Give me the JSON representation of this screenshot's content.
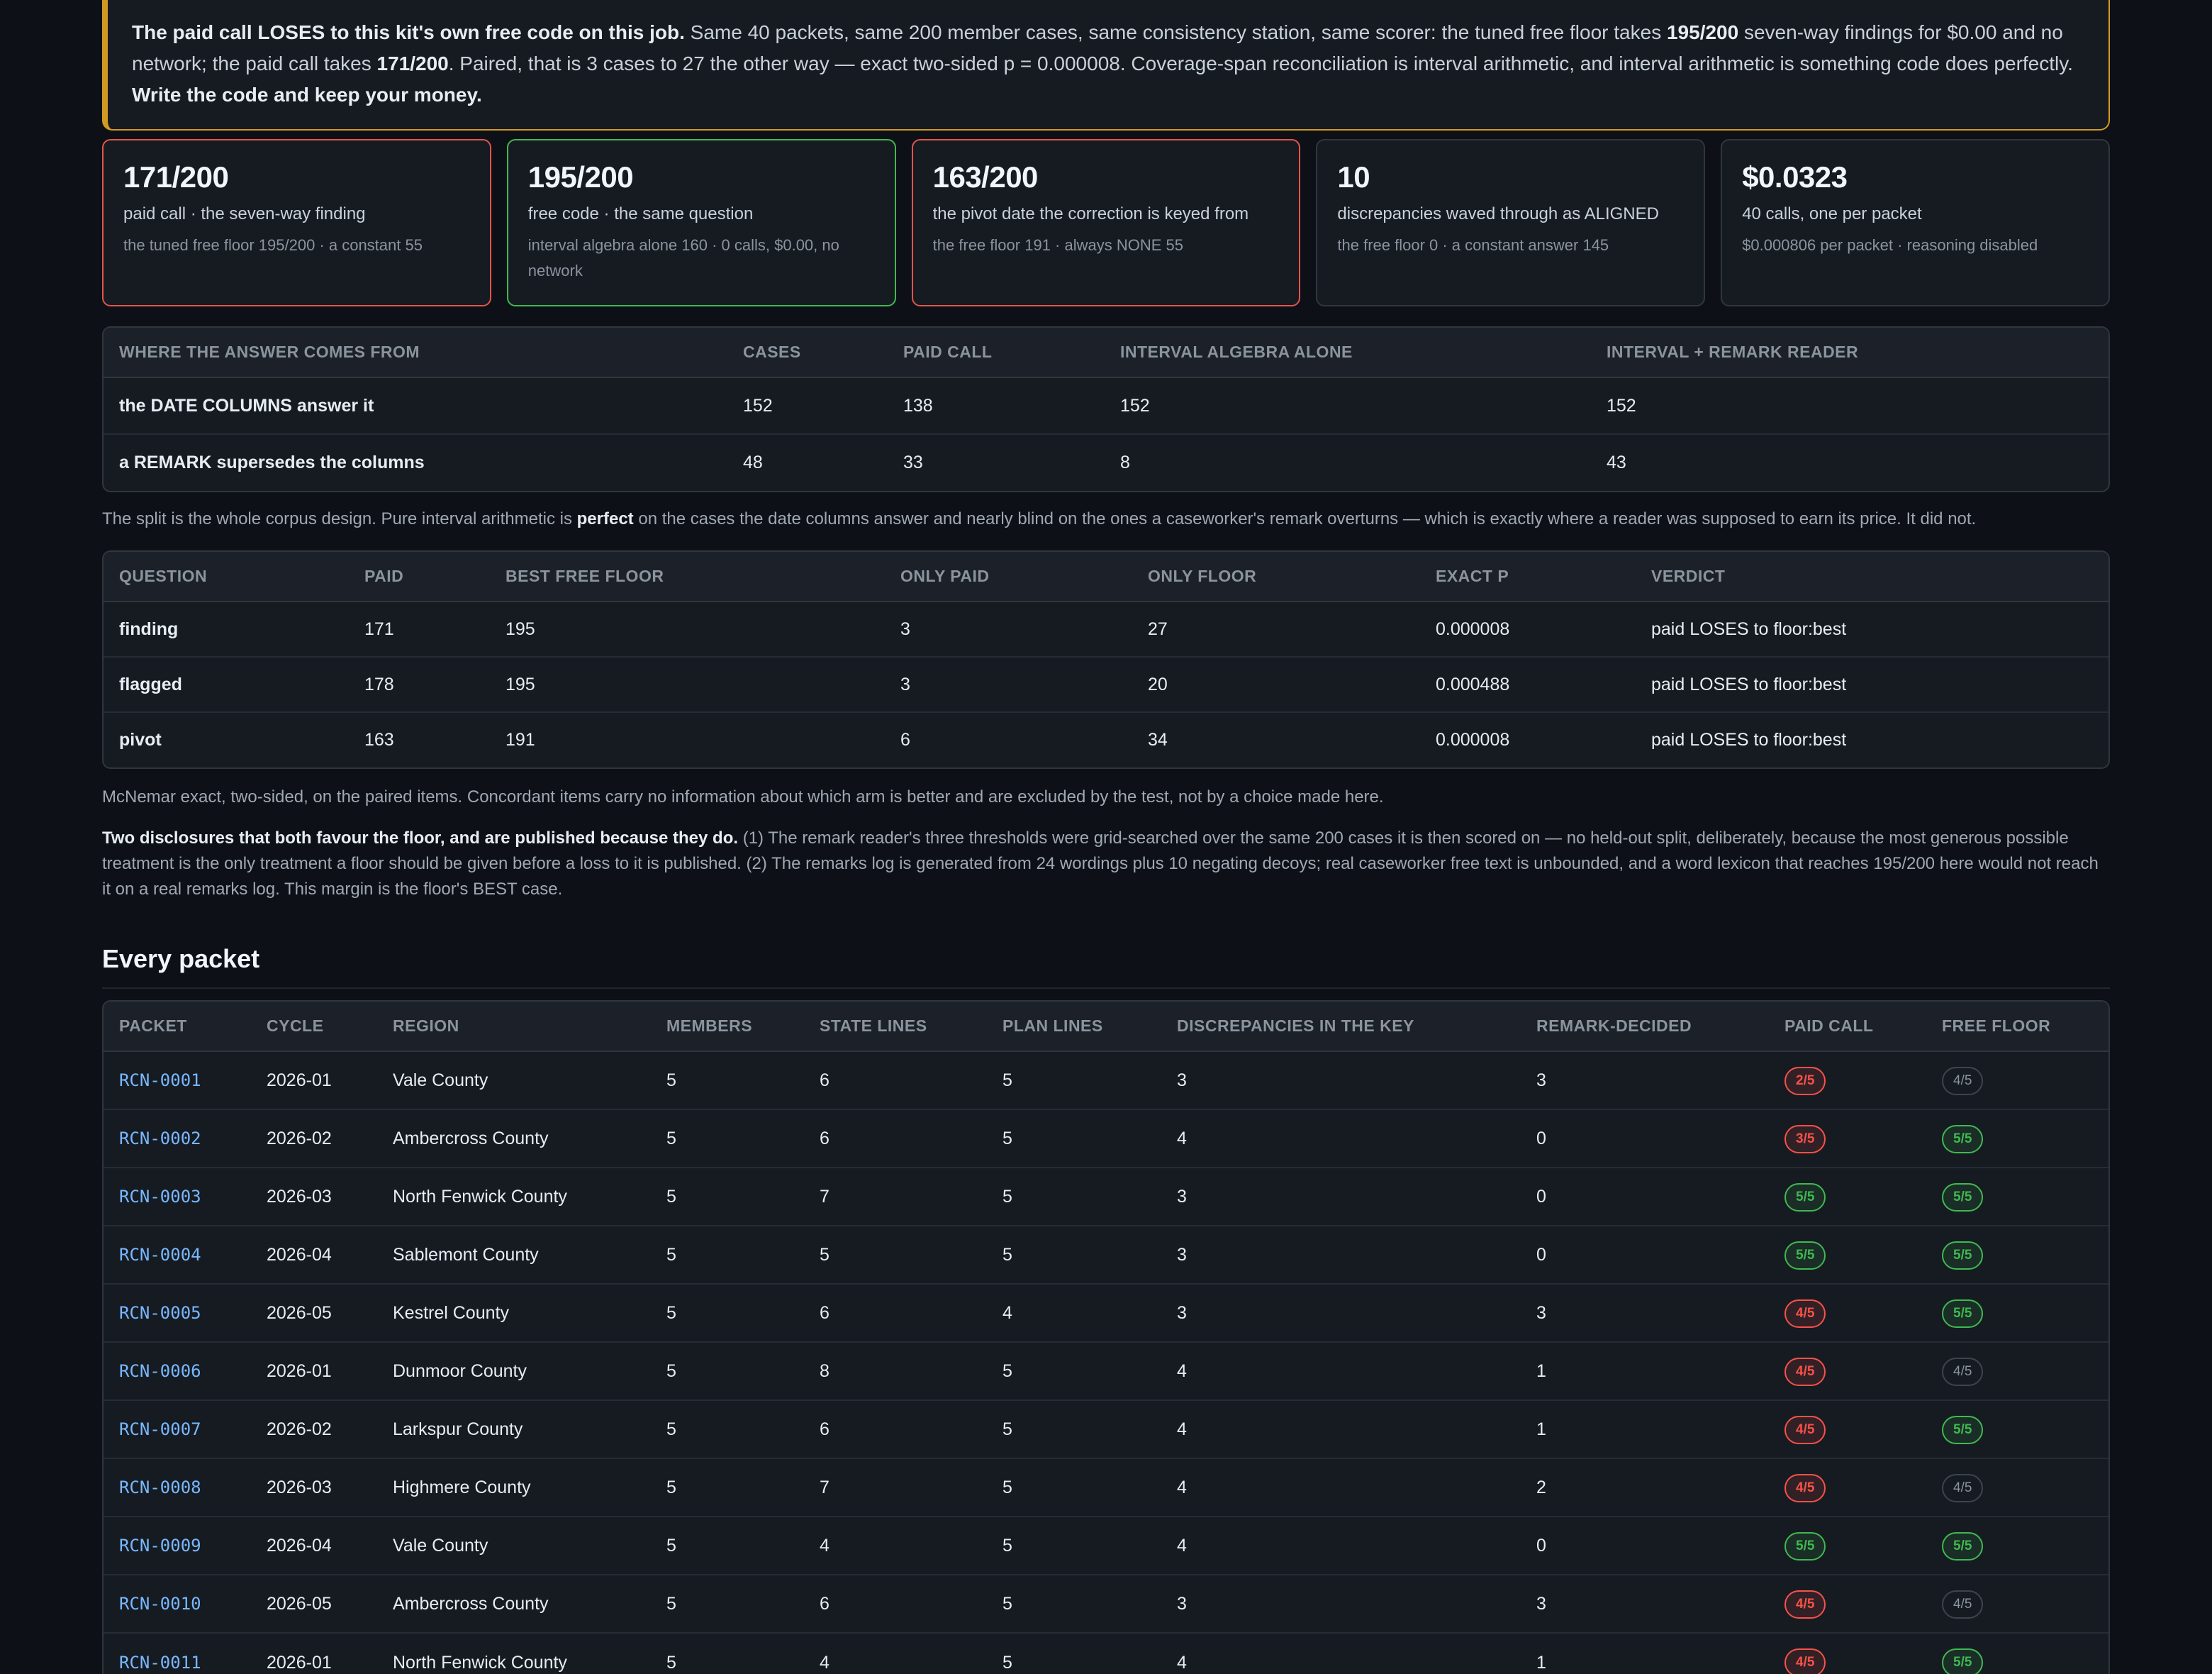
{
  "banner": {
    "lead": "The paid call LOSES to this kit's own free code on this job.",
    "t1": " Same 40 packets, same 200 member cases, same consistency station, same scorer: the tuned free floor takes ",
    "b1": "195/200",
    "t2": " seven-way findings for $0.00 and no network; the paid call takes ",
    "b2": "171/200",
    "t3": ". Paired, that is 3 cases to 27 the other way — exact two-sided p = 0.000008. Coverage-span reconciliation is interval arithmetic, and interval arithmetic is something code does perfectly. ",
    "tail": "Write the code and keep your money."
  },
  "cards": [
    {
      "big": "171/200",
      "label": "paid call · the seven-way finding",
      "sub": "the tuned free floor 195/200 · a constant 55",
      "tone": "red"
    },
    {
      "big": "195/200",
      "label": "free code · the same question",
      "sub": "interval algebra alone 160 · 0 calls, $0.00, no network",
      "tone": "green"
    },
    {
      "big": "163/200",
      "label": "the pivot date the correction is keyed from",
      "sub": "the free floor 191 · always NONE 55",
      "tone": "red"
    },
    {
      "big": "10",
      "label": "discrepancies waved through as ALIGNED",
      "sub": "the free floor 0 · a constant answer 145",
      "tone": "plain"
    },
    {
      "big": "$0.0323",
      "label": "40 calls, one per packet",
      "sub": "$0.000806 per packet · reasoning disabled",
      "tone": "plain"
    }
  ],
  "source_table": {
    "headers": [
      "WHERE THE ANSWER COMES FROM",
      "CASES",
      "PAID CALL",
      "INTERVAL ALGEBRA ALONE",
      "INTERVAL + REMARK READER"
    ],
    "rows": [
      [
        "the DATE COLUMNS answer it",
        "152",
        "138",
        "152",
        "152"
      ],
      [
        "a REMARK supersedes the columns",
        "48",
        "33",
        "8",
        "43"
      ]
    ]
  },
  "split_note": {
    "a": "The split is the whole corpus design. Pure interval arithmetic is ",
    "b": "perfect",
    "c": " on the cases the date columns answer and nearly blind on the ones a caseworker's remark overturns — which is exactly where a reader was supposed to earn its price. It did not."
  },
  "question_table": {
    "headers": [
      "QUESTION",
      "PAID",
      "BEST FREE FLOOR",
      "ONLY PAID",
      "ONLY FLOOR",
      "EXACT P",
      "VERDICT"
    ],
    "rows": [
      [
        "finding",
        "171",
        "195",
        "3",
        "27",
        "0.000008",
        "paid LOSES to floor:best"
      ],
      [
        "flagged",
        "178",
        "195",
        "3",
        "20",
        "0.000488",
        "paid LOSES to floor:best"
      ],
      [
        "pivot",
        "163",
        "191",
        "6",
        "34",
        "0.000008",
        "paid LOSES to floor:best"
      ]
    ]
  },
  "mcnemar_note": "McNemar exact, two-sided, on the paired items. Concordant items carry no information about which arm is better and are excluded by the test, not by a choice made here.",
  "disclosure": {
    "lead": "Two disclosures that both favour the floor, and are published because they do.",
    "body": " (1) The remark reader's three thresholds were grid-searched over the same 200 cases it is then scored on — no held-out split, deliberately, because the most generous possible treatment is the only treatment a floor should be given before a loss to it is published. (2) The remarks log is generated from 24 wordings plus 10 negating decoys; real caseworker free text is unbounded, and a word lexicon that reaches 195/200 here would not reach it on a real remarks log. This margin is the floor's BEST case."
  },
  "packets": {
    "title": "Every packet",
    "headers": [
      "PACKET",
      "CYCLE",
      "REGION",
      "MEMBERS",
      "STATE LINES",
      "PLAN LINES",
      "DISCREPANCIES IN THE KEY",
      "REMARK-DECIDED",
      "PAID CALL",
      "FREE FLOOR"
    ],
    "rows": [
      {
        "id": "RCN-0001",
        "cycle": "2026-01",
        "region": "Vale County",
        "members": "5",
        "state": "6",
        "plan": "5",
        "disc": "3",
        "remark": "3",
        "paid": "2/5",
        "paid_tone": "bad",
        "floor": "4/5",
        "floor_tone": "neutral"
      },
      {
        "id": "RCN-0002",
        "cycle": "2026-02",
        "region": "Ambercross County",
        "members": "5",
        "state": "6",
        "plan": "5",
        "disc": "4",
        "remark": "0",
        "paid": "3/5",
        "paid_tone": "bad",
        "floor": "5/5",
        "floor_tone": "good"
      },
      {
        "id": "RCN-0003",
        "cycle": "2026-03",
        "region": "North Fenwick County",
        "members": "5",
        "state": "7",
        "plan": "5",
        "disc": "3",
        "remark": "0",
        "paid": "5/5",
        "paid_tone": "good",
        "floor": "5/5",
        "floor_tone": "good"
      },
      {
        "id": "RCN-0004",
        "cycle": "2026-04",
        "region": "Sablemont County",
        "members": "5",
        "state": "5",
        "plan": "5",
        "disc": "3",
        "remark": "0",
        "paid": "5/5",
        "paid_tone": "good",
        "floor": "5/5",
        "floor_tone": "good"
      },
      {
        "id": "RCN-0005",
        "cycle": "2026-05",
        "region": "Kestrel County",
        "members": "5",
        "state": "6",
        "plan": "4",
        "disc": "3",
        "remark": "3",
        "paid": "4/5",
        "paid_tone": "bad",
        "floor": "5/5",
        "floor_tone": "good"
      },
      {
        "id": "RCN-0006",
        "cycle": "2026-01",
        "region": "Dunmoor County",
        "members": "5",
        "state": "8",
        "plan": "5",
        "disc": "4",
        "remark": "1",
        "paid": "4/5",
        "paid_tone": "bad",
        "floor": "4/5",
        "floor_tone": "neutral"
      },
      {
        "id": "RCN-0007",
        "cycle": "2026-02",
        "region": "Larkspur County",
        "members": "5",
        "state": "6",
        "plan": "5",
        "disc": "4",
        "remark": "1",
        "paid": "4/5",
        "paid_tone": "bad",
        "floor": "5/5",
        "floor_tone": "good"
      },
      {
        "id": "RCN-0008",
        "cycle": "2026-03",
        "region": "Highmere County",
        "members": "5",
        "state": "7",
        "plan": "5",
        "disc": "4",
        "remark": "2",
        "paid": "4/5",
        "paid_tone": "bad",
        "floor": "4/5",
        "floor_tone": "neutral"
      },
      {
        "id": "RCN-0009",
        "cycle": "2026-04",
        "region": "Vale County",
        "members": "5",
        "state": "4",
        "plan": "5",
        "disc": "4",
        "remark": "0",
        "paid": "5/5",
        "paid_tone": "good",
        "floor": "5/5",
        "floor_tone": "good"
      },
      {
        "id": "RCN-0010",
        "cycle": "2026-05",
        "region": "Ambercross County",
        "members": "5",
        "state": "6",
        "plan": "5",
        "disc": "3",
        "remark": "3",
        "paid": "4/5",
        "paid_tone": "bad",
        "floor": "4/5",
        "floor_tone": "neutral"
      },
      {
        "id": "RCN-0011",
        "cycle": "2026-01",
        "region": "North Fenwick County",
        "members": "5",
        "state": "4",
        "plan": "5",
        "disc": "4",
        "remark": "1",
        "paid": "4/5",
        "paid_tone": "bad",
        "floor": "5/5",
        "floor_tone": "good"
      }
    ]
  },
  "colors": {
    "accent_warning": "#d29922",
    "bad": "#f85149",
    "good": "#3fb950",
    "link": "#79b8ff",
    "background": "#0d1117"
  }
}
